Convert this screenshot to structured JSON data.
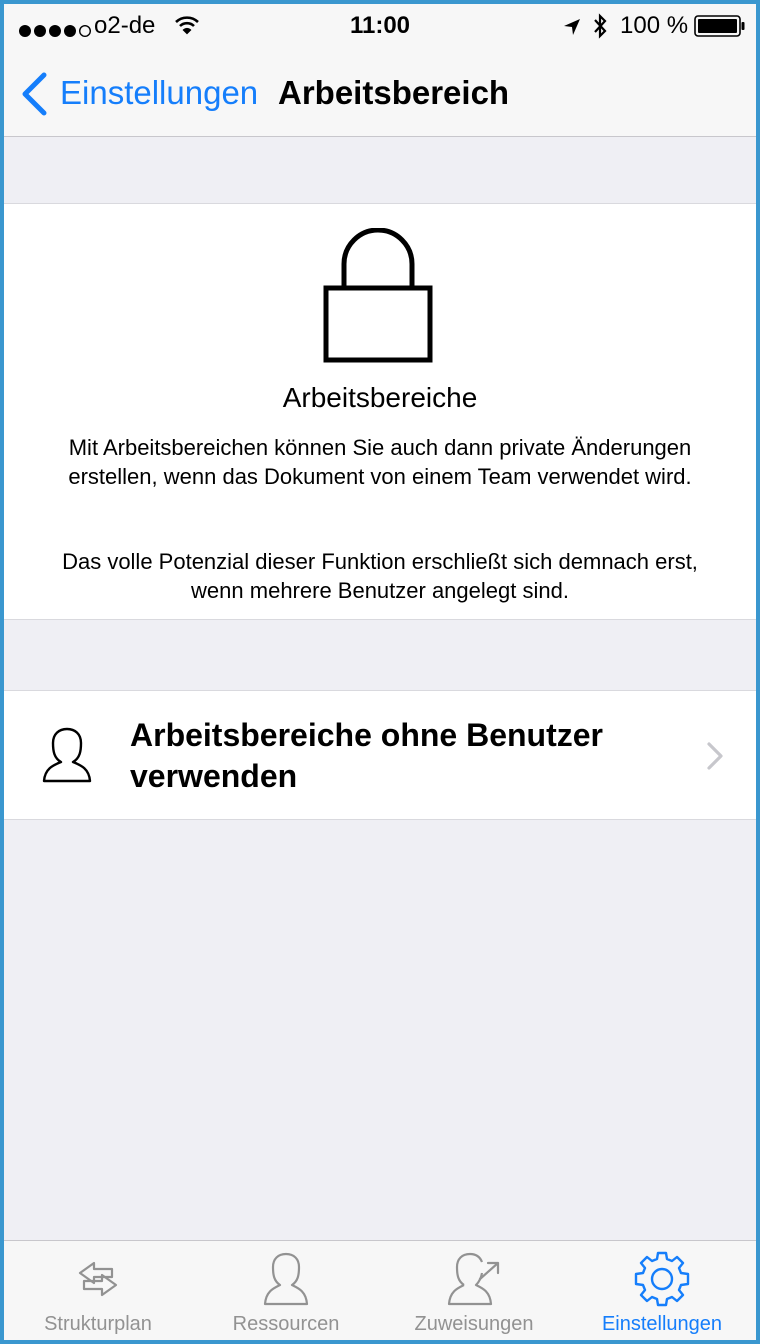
{
  "status": {
    "carrier": "o2-de",
    "time": "11:00",
    "battery": "100 %",
    "icons": [
      "signal-dots",
      "wifi-icon",
      "location-arrow-icon",
      "bluetooth-icon",
      "battery-icon"
    ]
  },
  "nav": {
    "back_label": "Einstellungen",
    "title": "Arbeitsbereich"
  },
  "info": {
    "icon": "lock-icon",
    "heading": "Arbeitsbereiche",
    "paragraph1": "Mit Arbeitsbereichen können Sie auch dann private Änderungen erstellen, wenn das Dokument von einem Team verwendet wird.",
    "paragraph2": "Das volle Potenzial dieser Funktion erschließt sich demnach erst, wenn mehrere Benutzer angelegt sind."
  },
  "action": {
    "icon": "person-icon",
    "label": "Arbeitsbereiche ohne Benutzer verwenden"
  },
  "tabs": [
    {
      "label": "Strukturplan",
      "icon": "arrows-icon",
      "active": false
    },
    {
      "label": "Ressourcen",
      "icon": "person-icon",
      "active": false
    },
    {
      "label": "Zuweisungen",
      "icon": "person-arrow-icon",
      "active": false
    },
    {
      "label": "Einstellungen",
      "icon": "gear-icon",
      "active": true
    }
  ],
  "colors": {
    "accent": "#157efb",
    "frame": "#3a97cf",
    "background": "#efeff4",
    "inactive_tab": "#929292"
  }
}
